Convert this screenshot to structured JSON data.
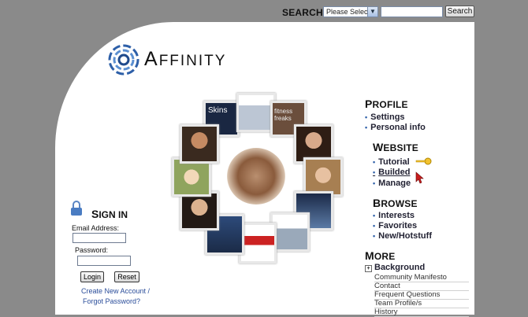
{
  "search": {
    "label": "SEARCH:",
    "select_value": "Please Select",
    "button": "Search"
  },
  "logo": {
    "first": "A",
    "rest": "FFINITY"
  },
  "profile": {
    "title_cap": "P",
    "title_rest": "ROFILE",
    "items": [
      "Settings",
      "Personal info"
    ]
  },
  "website": {
    "title_cap": "W",
    "title_rest": "EBSITE",
    "items": [
      "Tutorial",
      "Builded",
      "Manage"
    ]
  },
  "browse": {
    "title_cap": "B",
    "title_rest": "ROWSE",
    "items": [
      "Interests",
      "Favorites",
      "New/Hotstuff"
    ]
  },
  "more": {
    "title_cap": "M",
    "title_rest": "ORE",
    "expand": "Background",
    "items": [
      "Community Manifesto",
      "Contact",
      "Frequent Questions",
      "Team Profile/s",
      "History"
    ]
  },
  "signin": {
    "title_cap": "S",
    "title_rest": "IGN IN",
    "email_label": "Email Address:",
    "password_label": "Password:",
    "login": "Login",
    "reset": "Reset",
    "create": "Create New Account /",
    "forgot": "Forgot Password?"
  },
  "collage": {
    "text1": "Skins",
    "text2": "fitness freaks"
  },
  "colors": {
    "accent": "#2d5fa8",
    "link": "#2a4d9a",
    "background": "#8a8a8a"
  }
}
